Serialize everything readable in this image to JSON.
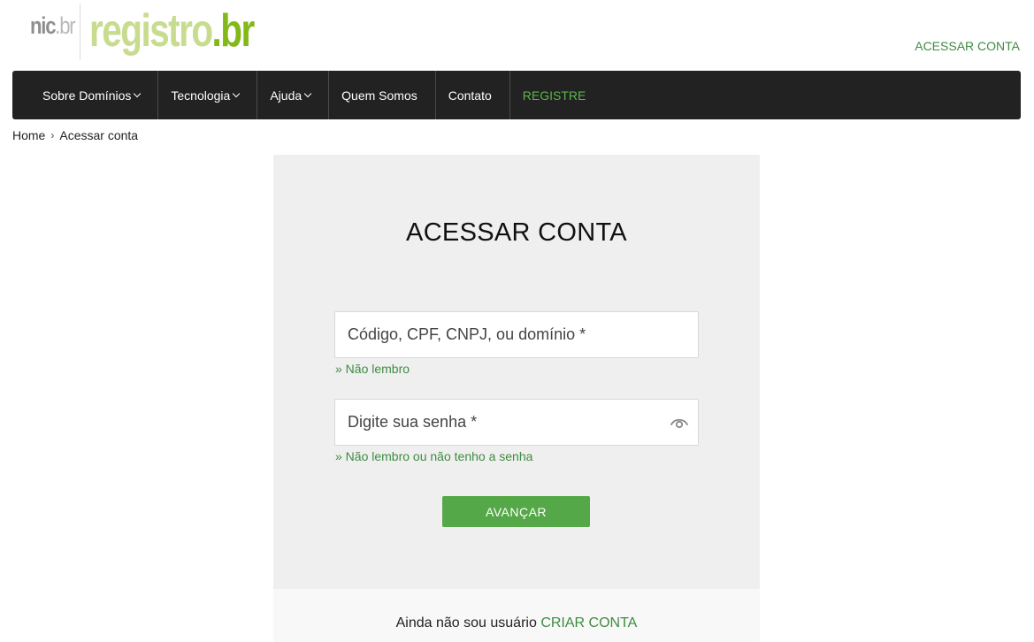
{
  "header": {
    "logo_nic": "nic",
    "logo_nic_br": ".br",
    "logo_registro": "registro",
    "logo_registro_br": ".br",
    "top_link": "ACESSAR CONTA"
  },
  "nav": {
    "items": [
      {
        "label": "Sobre Domínios",
        "dropdown": true
      },
      {
        "label": "Tecnologia",
        "dropdown": true
      },
      {
        "label": "Ajuda",
        "dropdown": true
      },
      {
        "label": "Quem Somos",
        "dropdown": false
      },
      {
        "label": "Contato",
        "dropdown": false
      },
      {
        "label": "REGISTRE",
        "dropdown": false
      }
    ]
  },
  "breadcrumb": {
    "home": "Home",
    "separator": "›",
    "current": "Acessar conta"
  },
  "login": {
    "title": "ACESSAR CONTA",
    "user_placeholder": "Código, CPF, CNPJ, ou domínio *",
    "user_value": "",
    "user_help": "» Não lembro",
    "password_placeholder": "Digite sua senha *",
    "password_value": "",
    "password_help": "» Não lembro ou não tenho a senha",
    "submit_label": "AVANÇAR"
  },
  "signup": {
    "text": "Ainda não sou usuário",
    "link": "CRIAR CONTA"
  },
  "colors": {
    "nav_bg": "#222222",
    "accent_green": "#55a847",
    "link_green": "#3d8c40",
    "card_bg": "#efefef"
  }
}
